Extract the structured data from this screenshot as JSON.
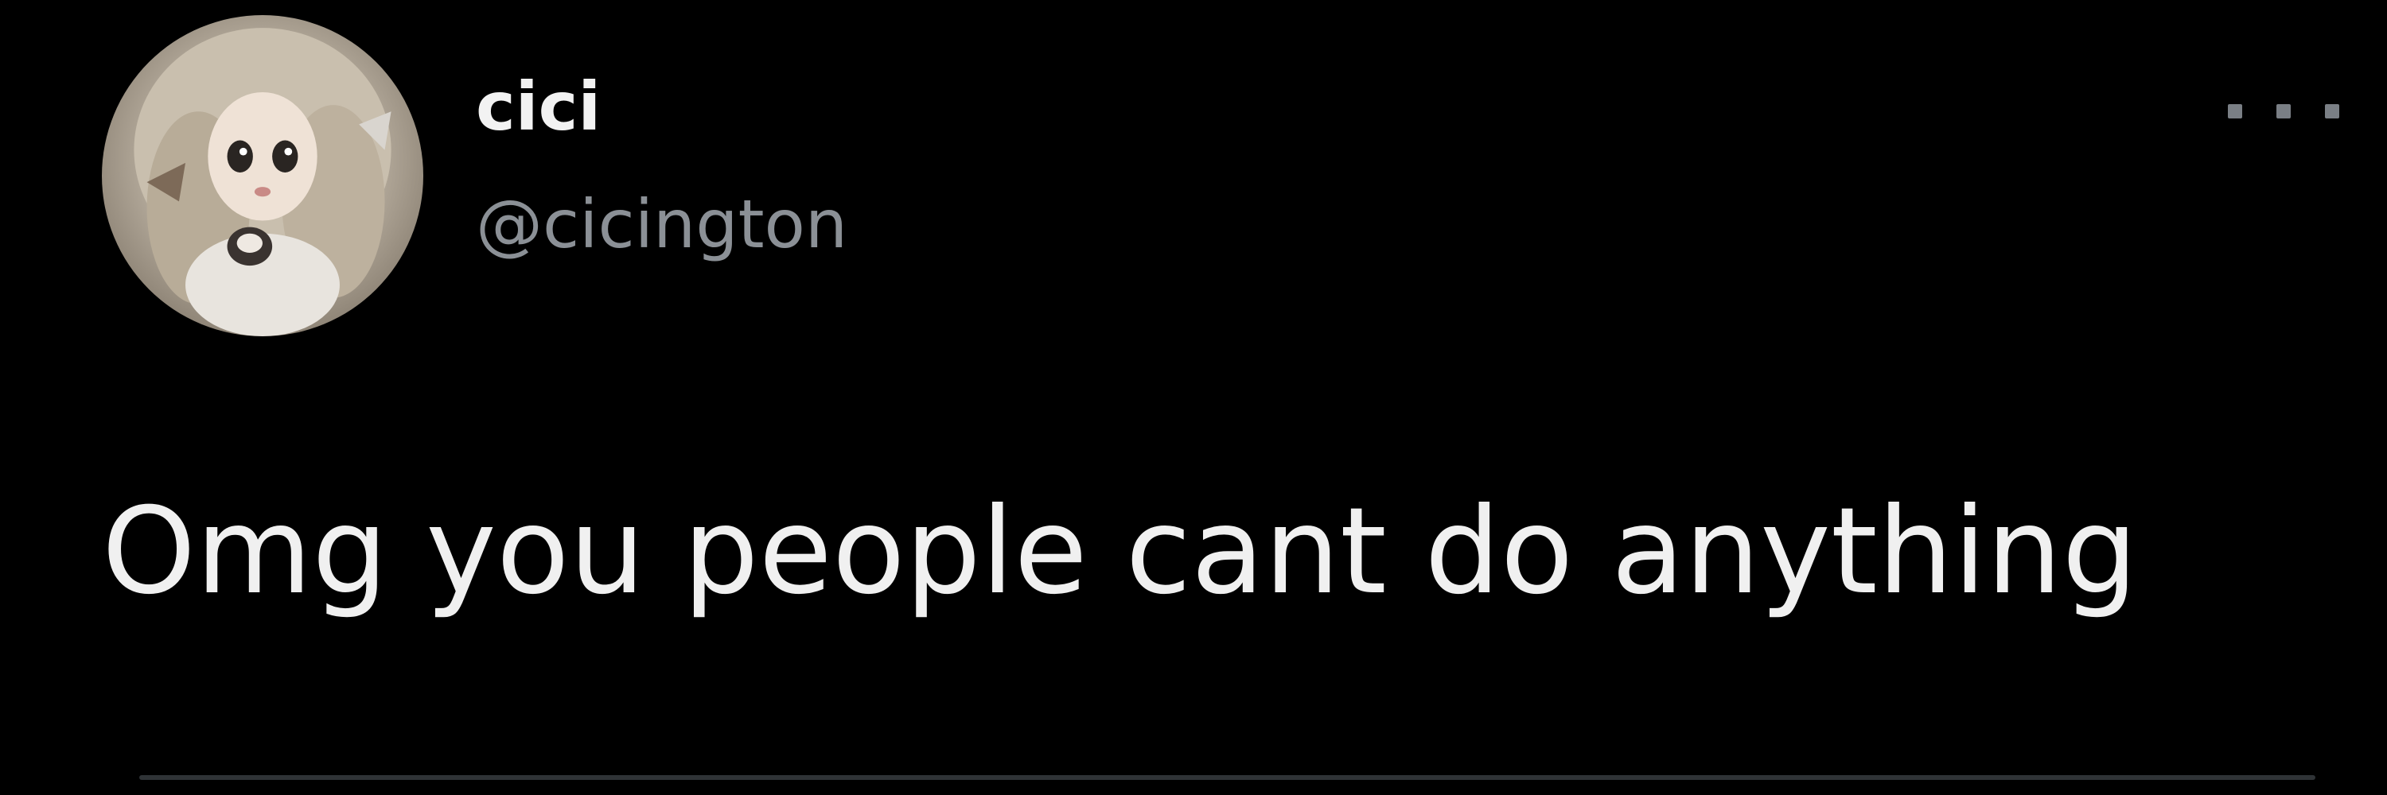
{
  "tweet": {
    "author": {
      "display_name": "cici",
      "handle": "@cicington",
      "avatar_icon": "doll-avatar"
    },
    "more_icon": "more-horizontal-icon",
    "text": "Omg you people cant do anything"
  },
  "colors": {
    "background": "#000000",
    "text_primary": "#f0f0f0",
    "text_secondary": "#8b9096",
    "divider": "#2f3336"
  }
}
